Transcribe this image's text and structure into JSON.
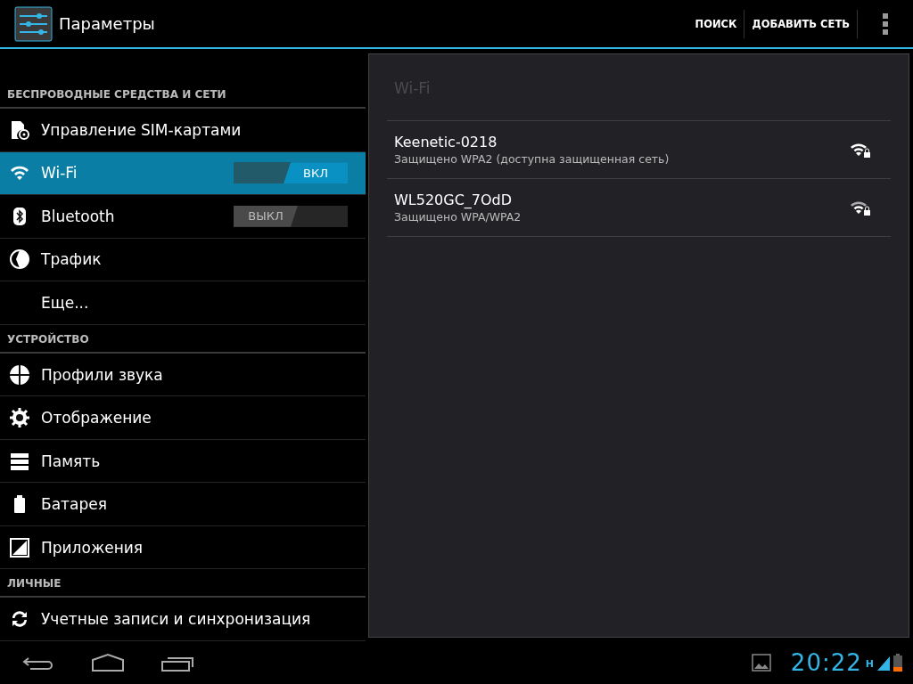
{
  "action_bar": {
    "title": "Параметры",
    "actions": [
      "ПОИСК",
      "ДОБАВИТЬ СЕТЬ"
    ]
  },
  "sidebar": {
    "sections": [
      {
        "header": "БЕСПРОВОДНЫЕ СРЕДСТВА И СЕТИ",
        "items": [
          {
            "label": "Управление SIM-картами",
            "kind": "plain",
            "selected": false
          },
          {
            "label": "Wi-Fi",
            "kind": "toggle",
            "on": true,
            "toggle_text": "ВКЛ",
            "selected": true
          },
          {
            "label": "Bluetooth",
            "kind": "toggle",
            "on": false,
            "toggle_text": "ВЫКЛ",
            "selected": false
          },
          {
            "label": "Трафик",
            "kind": "plain",
            "selected": false
          },
          {
            "label": "Еще...",
            "kind": "plain",
            "selected": false
          }
        ]
      },
      {
        "header": "УСТРОЙСТВО",
        "items": [
          {
            "label": "Профили звука",
            "kind": "plain",
            "selected": false
          },
          {
            "label": "Отображение",
            "kind": "plain",
            "selected": false
          },
          {
            "label": "Память",
            "kind": "plain",
            "selected": false
          },
          {
            "label": "Батарея",
            "kind": "plain",
            "selected": false
          },
          {
            "label": "Приложения",
            "kind": "plain",
            "selected": false
          }
        ]
      },
      {
        "header": "ЛИЧНЫЕ",
        "items": [
          {
            "label": "Учетные записи и синхронизация",
            "kind": "plain",
            "selected": false
          }
        ]
      }
    ]
  },
  "detail": {
    "title": "Wi-Fi",
    "networks": [
      {
        "name": "Keenetic-0218",
        "status": "Защищено WPA2 (доступна защищенная сеть)"
      },
      {
        "name": "WL520GC_7OdD",
        "status": "Защищено WPA/WPA2"
      }
    ]
  },
  "status_bar": {
    "time": "20:22",
    "network_type": "H"
  }
}
